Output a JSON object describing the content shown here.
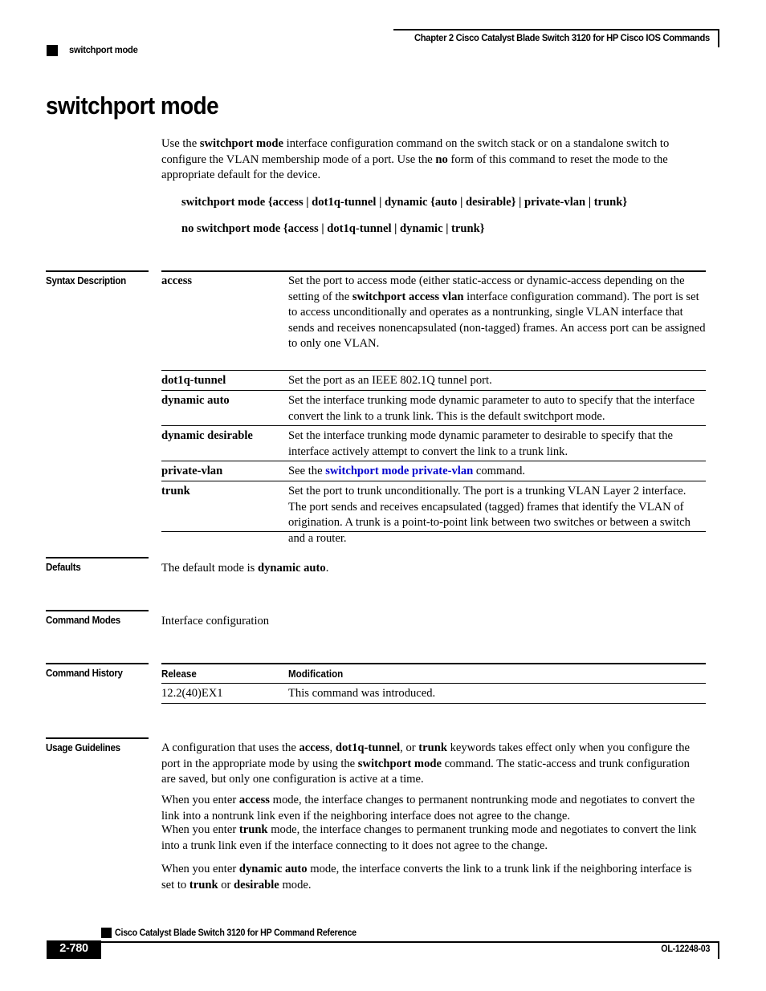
{
  "header": {
    "chapter": "Chapter  2 Cisco Catalyst Blade Switch 3120 for HP Cisco IOS Commands",
    "running_head": "switchport mode"
  },
  "title": "switchport mode",
  "intro": {
    "p1_a": "Use the ",
    "p1_b": "switchport mode",
    "p1_c": " interface configuration command on the switch stack or on a standalone switch to configure the VLAN membership mode of a port. Use the ",
    "p1_d": "no",
    "p1_e": " form of this command to reset the mode to the appropriate default for the device."
  },
  "syntax": {
    "line1": "switchport mode {access | dot1q-tunnel | dynamic {auto | desirable} | private-vlan | trunk}",
    "line2": "no switchport mode {access | dot1q-tunnel | dynamic | trunk}"
  },
  "sections": {
    "syntax_description": "Syntax Description",
    "defaults": "Defaults",
    "command_modes": "Command Modes",
    "command_history": "Command History",
    "usage_guidelines": "Usage Guidelines"
  },
  "syntax_table": {
    "rows": [
      {
        "term": "access",
        "desc_a": "Set the port to access mode (either static-access or dynamic-access depending on the setting of the ",
        "desc_b": "switchport access vlan",
        "desc_c": " interface configuration command). The port is set to access unconditionally and operates as a nontrunking, single VLAN interface that sends and receives nonencapsulated (non-tagged) frames. An access port can be assigned to only one VLAN."
      },
      {
        "term": "dot1q-tunnel",
        "desc_a": "Set the port as an IEEE 802.1Q tunnel port.",
        "desc_b": "",
        "desc_c": ""
      },
      {
        "term": "dynamic auto",
        "desc_a": "Set the interface trunking mode dynamic parameter to auto to specify that the interface convert the link to a trunk link. This is the default switchport mode.",
        "desc_b": "",
        "desc_c": ""
      },
      {
        "term": "dynamic desirable",
        "desc_a": "Set the interface trunking mode dynamic parameter to desirable to specify that the interface actively attempt to convert the link to a trunk link.",
        "desc_b": "",
        "desc_c": ""
      },
      {
        "term": "private-vlan",
        "desc_a": "See the ",
        "desc_b": "switchport mode private-vlan",
        "desc_c": " command.",
        "link": true
      },
      {
        "term": "trunk",
        "desc_a": "Set the port to trunk unconditionally. The port is a trunking VLAN Layer 2 interface. The port sends and receives encapsulated (tagged) frames that identify the VLAN of origination. A trunk is a point-to-point link between two switches or between a switch and a router.",
        "desc_b": "",
        "desc_c": ""
      }
    ]
  },
  "defaults": {
    "text_a": "The default mode is ",
    "text_b": "dynamic auto",
    "text_c": "."
  },
  "command_modes": {
    "text": "Interface configuration"
  },
  "command_history": {
    "headers": {
      "release": "Release",
      "modification": "Modification"
    },
    "rows": [
      {
        "release": "12.2(40)EX1",
        "modification": "This command was introduced."
      }
    ]
  },
  "usage_guidelines": {
    "p1_a": "A configuration that uses the ",
    "p1_b": "access",
    "p1_c": ", ",
    "p1_d": "dot1q-tunnel",
    "p1_e": ", or ",
    "p1_f": "trunk",
    "p1_g": " keywords takes effect only when you configure the port in the appropriate mode by using the ",
    "p1_h": "switchport mode",
    "p1_i": " command. The static-access and trunk configuration are saved, but only one configuration is active at a time.",
    "p2_a": "When you enter ",
    "p2_b": "access",
    "p2_c": " mode, the interface changes to permanent nontrunking mode and negotiates to convert the link into a nontrunk link even if the neighboring interface does not agree to the change.",
    "p3_a": "When you enter ",
    "p3_b": "trunk",
    "p3_c": " mode, the interface changes to permanent trunking mode and negotiates to convert the link into a trunk link even if the interface connecting to it does not agree to the change.",
    "p4_a": "When you enter ",
    "p4_b": "dynamic auto",
    "p4_c": " mode, the interface converts the link to a trunk link if the neighboring interface is set to ",
    "p4_d": "trunk",
    "p4_e": " or ",
    "p4_f": "desirable",
    "p4_g": " mode."
  },
  "footer": {
    "book_title": "Cisco Catalyst Blade Switch 3120 for HP Command Reference",
    "page_number": "2-780",
    "doc_id": "OL-12248-03"
  },
  "colors": {
    "link": "#0000CC",
    "rule": "#000000"
  }
}
